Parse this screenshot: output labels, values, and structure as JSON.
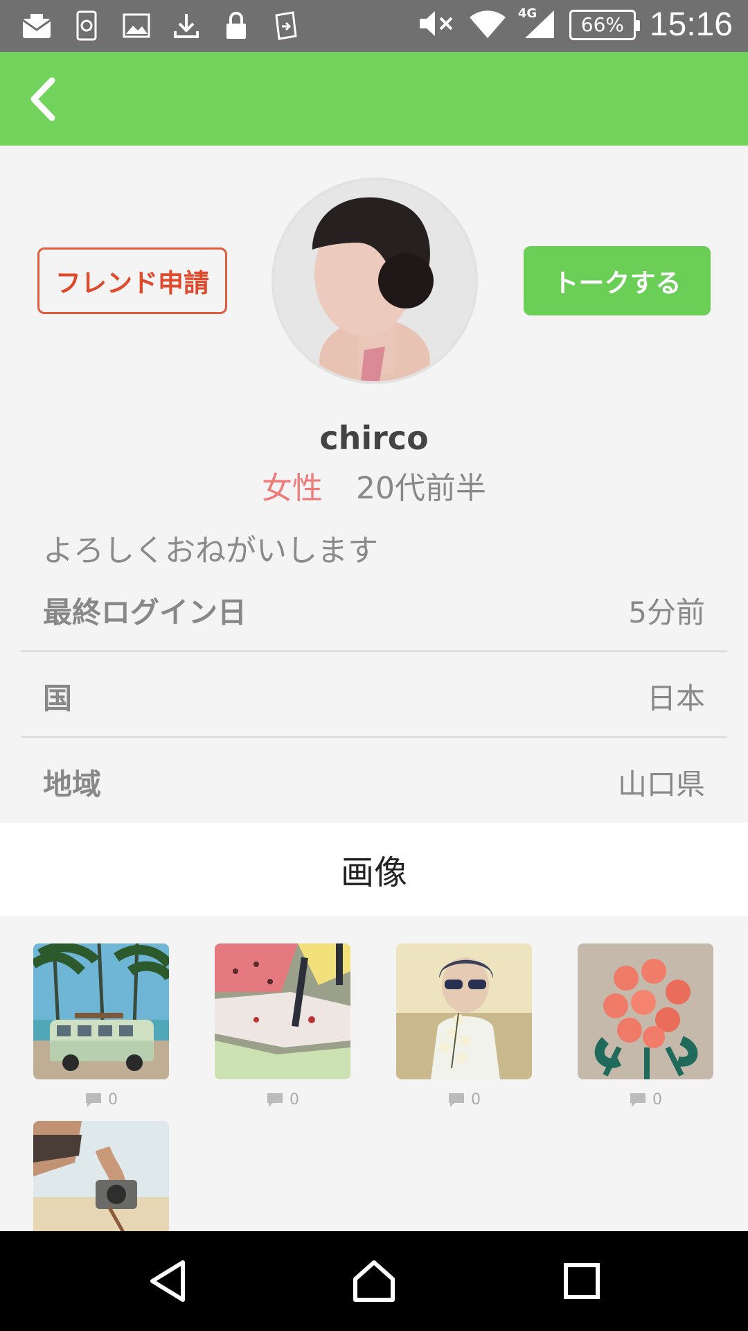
{
  "status_bar": {
    "left_icons": [
      "mail-icon",
      "sync-icon",
      "image-icon",
      "download-icon",
      "lock-icon",
      "app-icon"
    ],
    "network_label": "4G",
    "battery": "66%",
    "time": "15:16"
  },
  "header": {
    "back_icon": "chevron-left-icon"
  },
  "profile": {
    "friend_request_label": "フレンド申請",
    "talk_label": "トークする",
    "username": "chirco",
    "gender": "女性",
    "age": "20代前半",
    "bio": "よろしくおねがいします"
  },
  "details": [
    {
      "label": "最終ログイン日",
      "value": "5分前"
    },
    {
      "label": "国",
      "value": "日本"
    },
    {
      "label": "地域",
      "value": "山口県"
    }
  ],
  "images_section": {
    "title": "画像",
    "items": [
      {
        "subject": "beach-van-photo",
        "comments": "0"
      },
      {
        "subject": "gelato-photo",
        "comments": "0"
      },
      {
        "subject": "woman-sunglasses-photo",
        "comments": "0"
      },
      {
        "subject": "roses-photo",
        "comments": "0"
      },
      {
        "subject": "camera-beach-photo",
        "comments": null
      }
    ]
  },
  "colors": {
    "accent_green": "#72d35c",
    "button_green": "#6bcf57",
    "friend_red": "#e04a2c",
    "gender_pink": "#f07a7a"
  }
}
